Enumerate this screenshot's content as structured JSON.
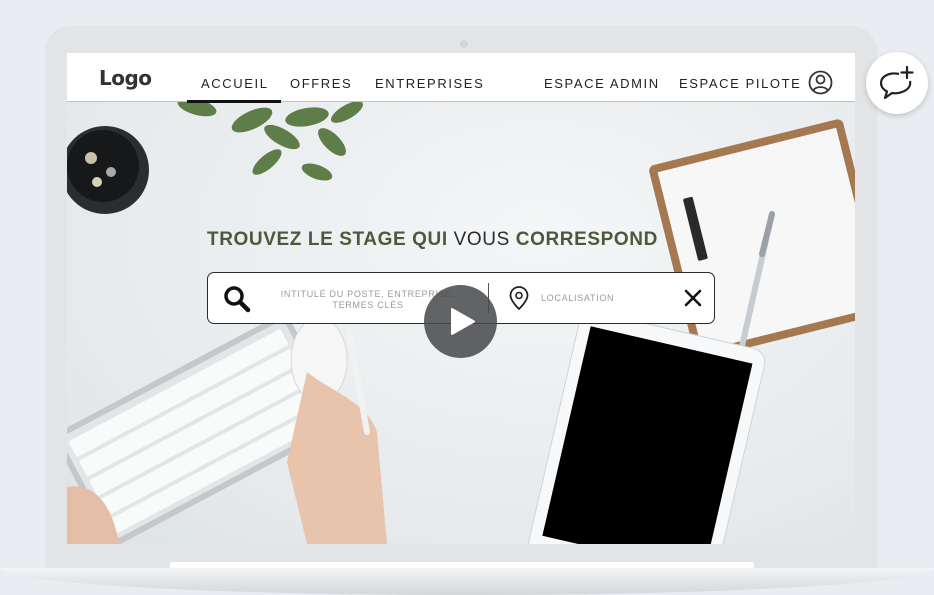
{
  "navbar": {
    "logo": "Logo",
    "items": [
      {
        "label": "ACCUEIL",
        "active": true
      },
      {
        "label": "OFFRES",
        "active": false
      },
      {
        "label": "ENTREPRISES",
        "active": false
      }
    ],
    "right_items": [
      {
        "label": "ESPACE ADMIN"
      },
      {
        "label": "ESPACE PILOTE"
      }
    ],
    "user_icon": "user-circle-icon"
  },
  "hero": {
    "headline_part1": "TROUVEZ LE STAGE QUI",
    "headline_part2": "VOUS",
    "headline_part3": "CORRESPOND",
    "search": {
      "keywords_placeholder": "INTITULÉ DU POSTE, ENTREPRISE, TERMES CLÉS",
      "location_placeholder": "LOCALISATION",
      "search_icon": "search-icon",
      "location_icon": "map-pin-icon",
      "clear_icon": "close-icon"
    },
    "play_icon": "play-icon"
  },
  "floating": {
    "chat_icon": "chat-add-icon"
  },
  "colors": {
    "headline_green": "#4b5a3a",
    "navbar_bg": "#ffffff",
    "play_bg": "#46484a"
  }
}
